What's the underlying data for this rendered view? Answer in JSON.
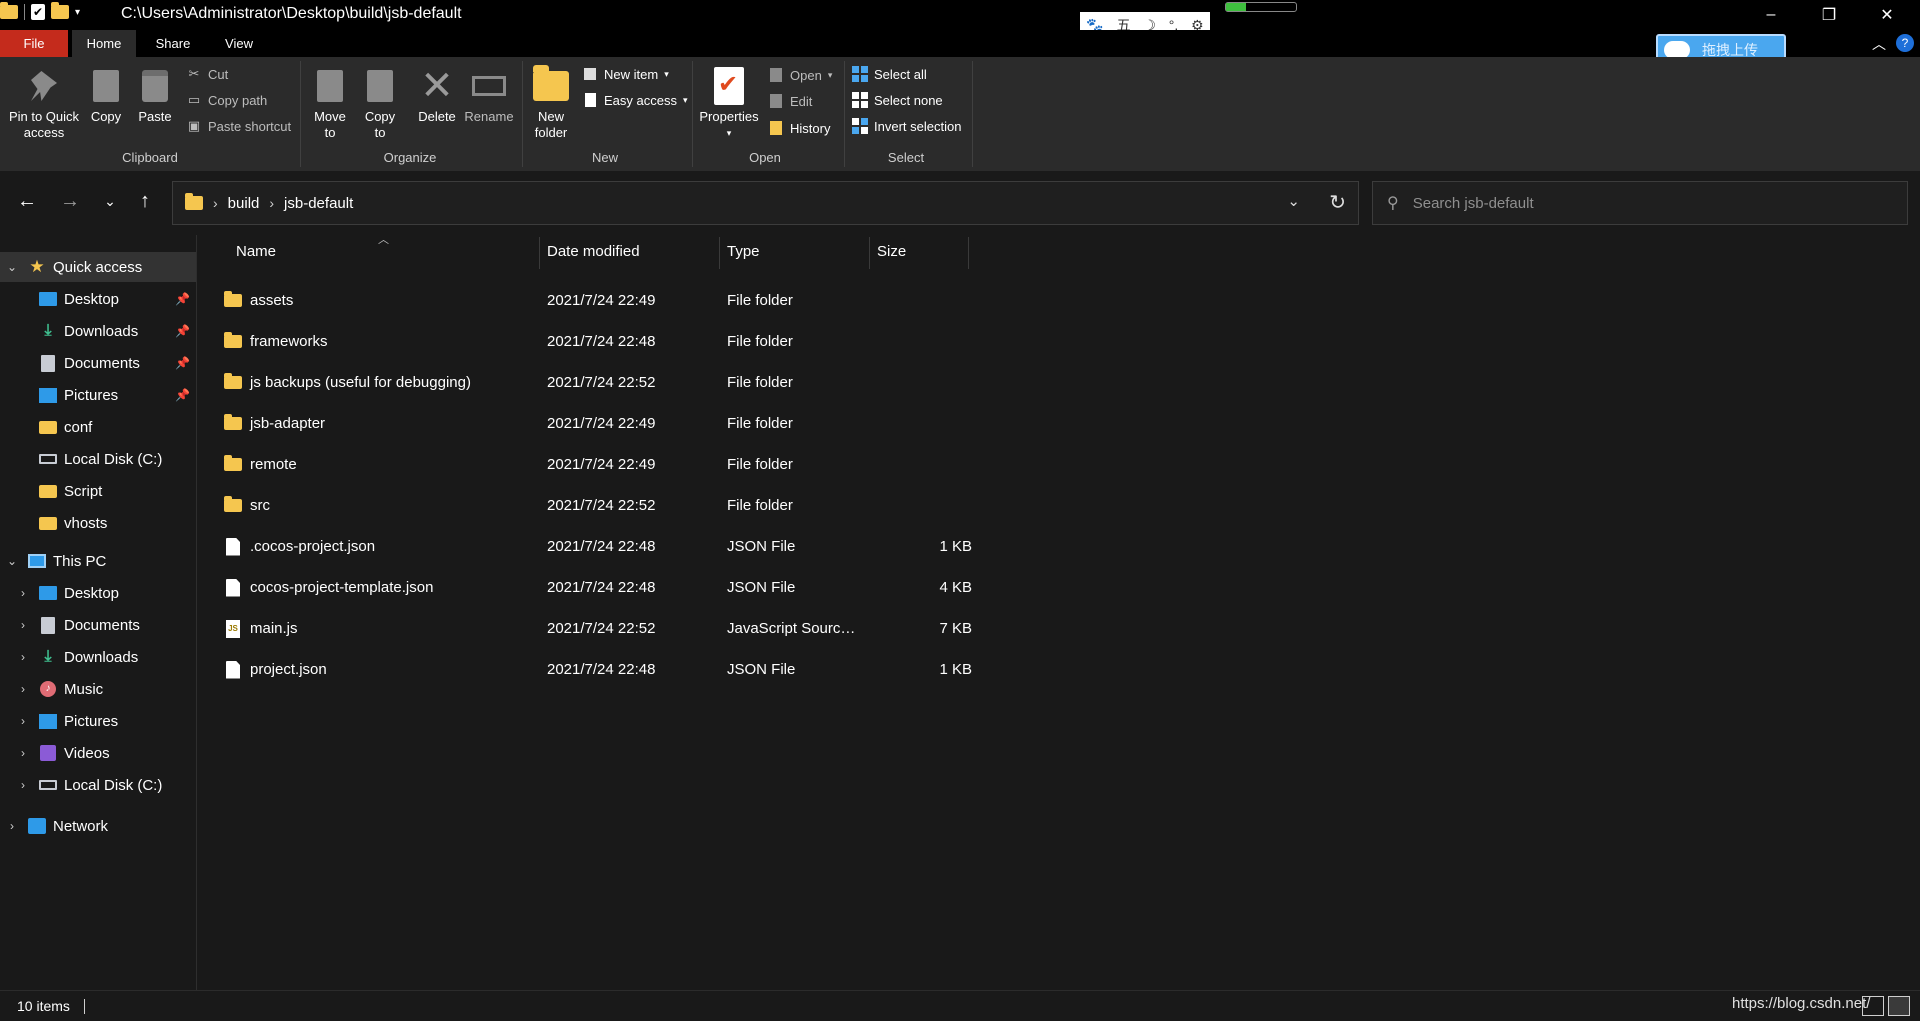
{
  "titlebar": {
    "path": "C:\\Users\\Administrator\\Desktop\\build\\jsb-default",
    "ime": [
      "五",
      "☽",
      "°,",
      "⚙"
    ],
    "controls": [
      "–",
      "❐",
      "✕"
    ]
  },
  "ribbon_tabs": {
    "file": "File",
    "home": "Home",
    "share": "Share",
    "view": "View"
  },
  "upload_button": "拖拽上传",
  "help": "?",
  "ribbon": {
    "clipboard": {
      "label": "Clipboard",
      "pin": "Pin to Quick access",
      "copy": "Copy",
      "paste": "Paste",
      "cut": "Cut",
      "copy_path": "Copy path",
      "paste_shortcut": "Paste shortcut"
    },
    "organize": {
      "label": "Organize",
      "move_to": "Move to",
      "copy_to": "Copy to",
      "delete": "Delete",
      "rename": "Rename"
    },
    "new": {
      "label": "New",
      "new_folder": "New folder",
      "new_item": "New item",
      "easy_access": "Easy access"
    },
    "open": {
      "label": "Open",
      "properties": "Properties",
      "open": "Open",
      "edit": "Edit",
      "history": "History"
    },
    "select": {
      "label": "Select",
      "select_all": "Select all",
      "select_none": "Select none",
      "invert_selection": "Invert selection"
    }
  },
  "address": {
    "crumbs": [
      "build",
      "jsb-default"
    ],
    "search_placeholder": "Search jsb-default"
  },
  "navpane": {
    "quick_access": {
      "label": "Quick access",
      "items": [
        {
          "label": "Desktop",
          "icon": "desktop-icon",
          "pinned": true
        },
        {
          "label": "Downloads",
          "icon": "downloads-icon",
          "pinned": true
        },
        {
          "label": "Documents",
          "icon": "documents-icon",
          "pinned": true
        },
        {
          "label": "Pictures",
          "icon": "pictures-icon",
          "pinned": true
        },
        {
          "label": "conf",
          "icon": "folder-icon",
          "pinned": false
        },
        {
          "label": "Local Disk (C:)",
          "icon": "disk-icon",
          "pinned": false
        },
        {
          "label": "Script",
          "icon": "folder-icon",
          "pinned": false
        },
        {
          "label": "vhosts",
          "icon": "folder-icon",
          "pinned": false
        }
      ]
    },
    "this_pc": {
      "label": "This PC",
      "items": [
        {
          "label": "Desktop",
          "icon": "desktop-icon"
        },
        {
          "label": "Documents",
          "icon": "documents-icon"
        },
        {
          "label": "Downloads",
          "icon": "downloads-icon"
        },
        {
          "label": "Music",
          "icon": "music-icon"
        },
        {
          "label": "Pictures",
          "icon": "pictures-icon"
        },
        {
          "label": "Videos",
          "icon": "videos-icon"
        },
        {
          "label": "Local Disk (C:)",
          "icon": "disk-icon"
        }
      ]
    },
    "network": {
      "label": "Network"
    }
  },
  "filelist": {
    "columns": {
      "name": "Name",
      "date": "Date modified",
      "type": "Type",
      "size": "Size"
    },
    "rows": [
      {
        "name": "assets",
        "date": "2021/7/24 22:49",
        "type": "File folder",
        "size": "",
        "icon": "folder"
      },
      {
        "name": "frameworks",
        "date": "2021/7/24 22:48",
        "type": "File folder",
        "size": "",
        "icon": "folder"
      },
      {
        "name": "js backups (useful for debugging)",
        "date": "2021/7/24 22:52",
        "type": "File folder",
        "size": "",
        "icon": "folder"
      },
      {
        "name": "jsb-adapter",
        "date": "2021/7/24 22:49",
        "type": "File folder",
        "size": "",
        "icon": "folder"
      },
      {
        "name": "remote",
        "date": "2021/7/24 22:49",
        "type": "File folder",
        "size": "",
        "icon": "folder"
      },
      {
        "name": "src",
        "date": "2021/7/24 22:52",
        "type": "File folder",
        "size": "",
        "icon": "folder"
      },
      {
        "name": ".cocos-project.json",
        "date": "2021/7/24 22:48",
        "type": "JSON File",
        "size": "1 KB",
        "icon": "file"
      },
      {
        "name": "cocos-project-template.json",
        "date": "2021/7/24 22:48",
        "type": "JSON File",
        "size": "4 KB",
        "icon": "file"
      },
      {
        "name": "main.js",
        "date": "2021/7/24 22:52",
        "type": "JavaScript Source ...",
        "size": "7 KB",
        "icon": "js"
      },
      {
        "name": "project.json",
        "date": "2021/7/24 22:48",
        "type": "JSON File",
        "size": "1 KB",
        "icon": "file"
      }
    ]
  },
  "status": {
    "count": "10 items",
    "watermark": "https://blog.csdn.net/"
  },
  "colors": {
    "file_tab": "#c42b1c",
    "folder": "#f5c64f",
    "accent": "#4aa7ef",
    "background": "#191919"
  }
}
